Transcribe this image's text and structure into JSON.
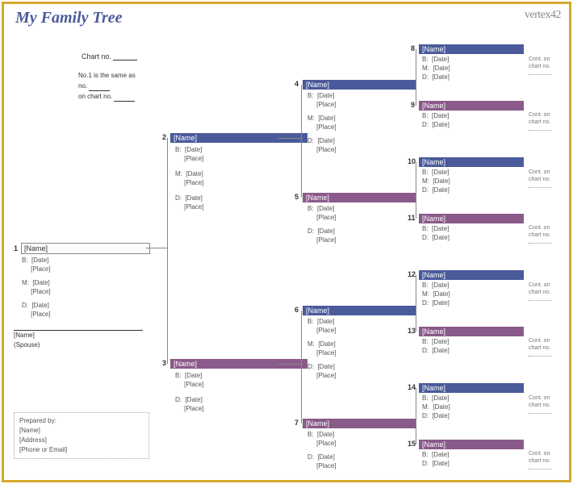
{
  "title": "My Family Tree",
  "logo": "vertex42",
  "chart_no_label": "Chart no.",
  "note_line1": "No.1 is the same as",
  "note_line2": "no.",
  "note_line3": "on chart no.",
  "labels": {
    "B": "B:",
    "M": "M:",
    "D": "D:",
    "date": "[Date]",
    "place": "[Place]",
    "name": "[Name]",
    "spouse": "(Spouse)",
    "cont1": "Cont. on",
    "cont2": "chart no."
  },
  "prepared": {
    "heading": "Prepared by:",
    "name": "[Name]",
    "address": "[Address]",
    "contact": "[Phone or Email]"
  },
  "persons": {
    "p1": "1",
    "p2": "2",
    "p3": "3",
    "p4": "4",
    "p5": "5",
    "p6": "6",
    "p7": "7",
    "p8": "8",
    "p9": "9",
    "p10": "10",
    "p11": "11",
    "p12": "12",
    "p13": "13",
    "p14": "14",
    "p15": "15"
  }
}
